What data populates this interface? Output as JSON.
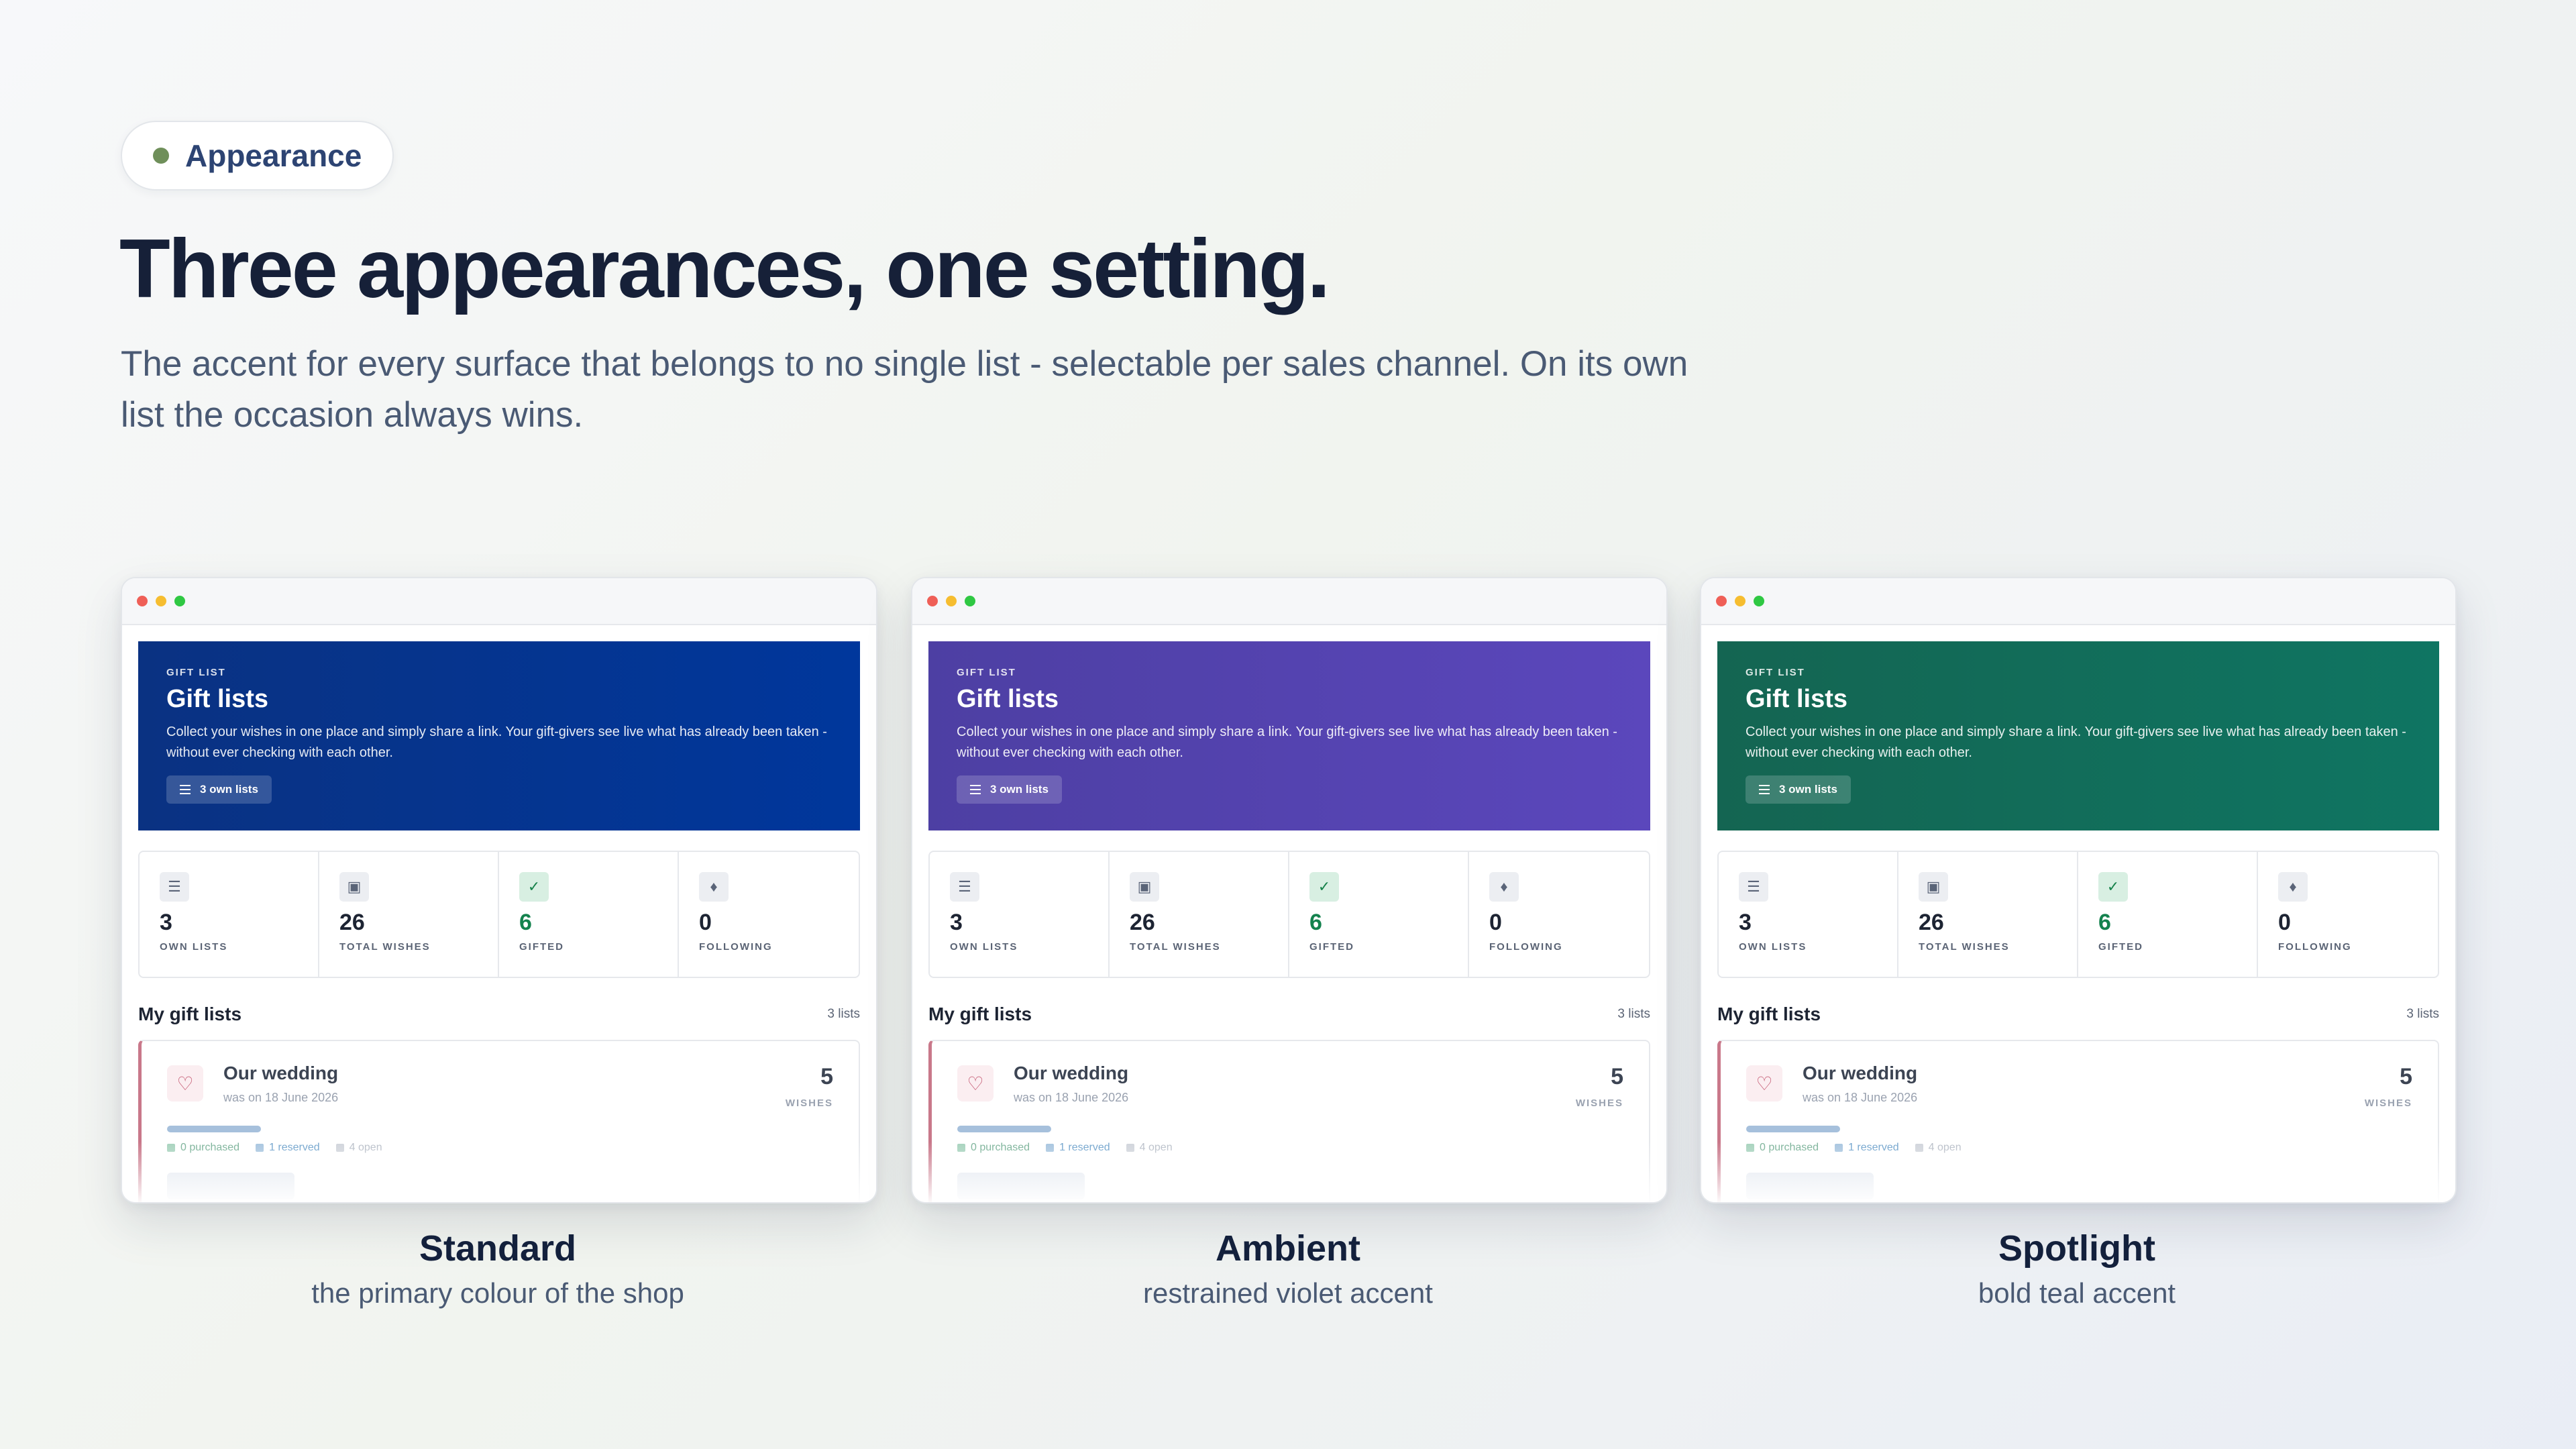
{
  "badge": {
    "label": "Appearance",
    "dot_color": "#6f8f5a"
  },
  "headline": "Three appearances, one setting.",
  "subtitle": "The accent for every surface that belongs to no single list - selectable per sales channel. On its own list the occasion always wins.",
  "preview": {
    "hero": {
      "eyebrow": "GIFT LIST",
      "title": "Gift lists",
      "description": "Collect your wishes in one place and simply share a link. Your gift-givers see live what has already been taken - without ever checking with each other.",
      "chip": "3 own lists"
    },
    "stats": [
      {
        "icon": "list-icon",
        "value": "3",
        "label": "OWN LISTS"
      },
      {
        "icon": "gift-icon",
        "value": "26",
        "label": "TOTAL WISHES"
      },
      {
        "icon": "check-icon",
        "value": "6",
        "label": "GIFTED"
      },
      {
        "icon": "bell-icon",
        "value": "0",
        "label": "FOLLOWING"
      }
    ],
    "list_title": "My gift lists",
    "list_count": "3 lists",
    "entry": {
      "name": "Our wedding",
      "date": "was on 18 June 2026",
      "count": "5",
      "unit": "WISHES",
      "purchased": "0 purchased",
      "reserved": "1 reserved",
      "open": "4 open"
    }
  },
  "variants": [
    {
      "name": "Standard",
      "description": "the primary colour of the shop",
      "accent_from": "#0a3282",
      "accent_to": "#00379c"
    },
    {
      "name": "Ambient",
      "description": "restrained violet accent",
      "accent_from": "#4d3fa3",
      "accent_to": "#5b47bc"
    },
    {
      "name": "Spotlight",
      "description": "bold teal accent",
      "accent_from": "#146552",
      "accent_to": "#0f7562"
    }
  ]
}
